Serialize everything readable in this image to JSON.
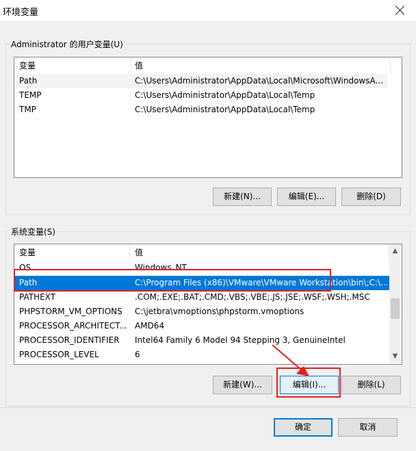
{
  "window": {
    "title": "环境变量"
  },
  "user_vars": {
    "legend": "Administrator 的用户变量(U)",
    "col_name": "变量",
    "col_value": "值",
    "rows": [
      {
        "name": "Path",
        "value": "C:\\Users\\Administrator\\AppData\\Local\\Microsoft\\WindowsA..."
      },
      {
        "name": "TEMP",
        "value": "C:\\Users\\Administrator\\AppData\\Local\\Temp"
      },
      {
        "name": "TMP",
        "value": "C:\\Users\\Administrator\\AppData\\Local\\Temp"
      }
    ],
    "new_label": "新建(N)...",
    "edit_label": "编辑(E)...",
    "delete_label": "删除(D)"
  },
  "system_vars": {
    "legend": "系统变量(S)",
    "col_name": "变量",
    "col_value": "值",
    "rows": [
      {
        "name": "OS",
        "value": "Windows_NT"
      },
      {
        "name": "Path",
        "value": "C:\\Program Files (x86)\\VMware\\VMware Workstation\\bin\\;C:\\..."
      },
      {
        "name": "PATHEXT",
        "value": ".COM;.EXE;.BAT;.CMD;.VBS;.VBE;.JS;.JSE;.WSF;.WSH;.MSC"
      },
      {
        "name": "PHPSTORM_VM_OPTIONS",
        "value": "C:\\jetbra\\vmoptions\\phpstorm.vmoptions"
      },
      {
        "name": "PROCESSOR_ARCHITECT...",
        "value": "AMD64"
      },
      {
        "name": "PROCESSOR_IDENTIFIER",
        "value": "Intel64 Family 6 Model 94 Stepping 3, GenuineIntel"
      },
      {
        "name": "PROCESSOR_LEVEL",
        "value": "6"
      }
    ],
    "selected_row": "Path",
    "new_label": "新建(W)...",
    "edit_label": "编辑(I)...",
    "delete_label": "删除(L)"
  },
  "footer": {
    "ok_label": "确定",
    "cancel_label": "取消"
  },
  "colors": {
    "selection": "#0078d7",
    "highlight": "#e31f1f"
  }
}
